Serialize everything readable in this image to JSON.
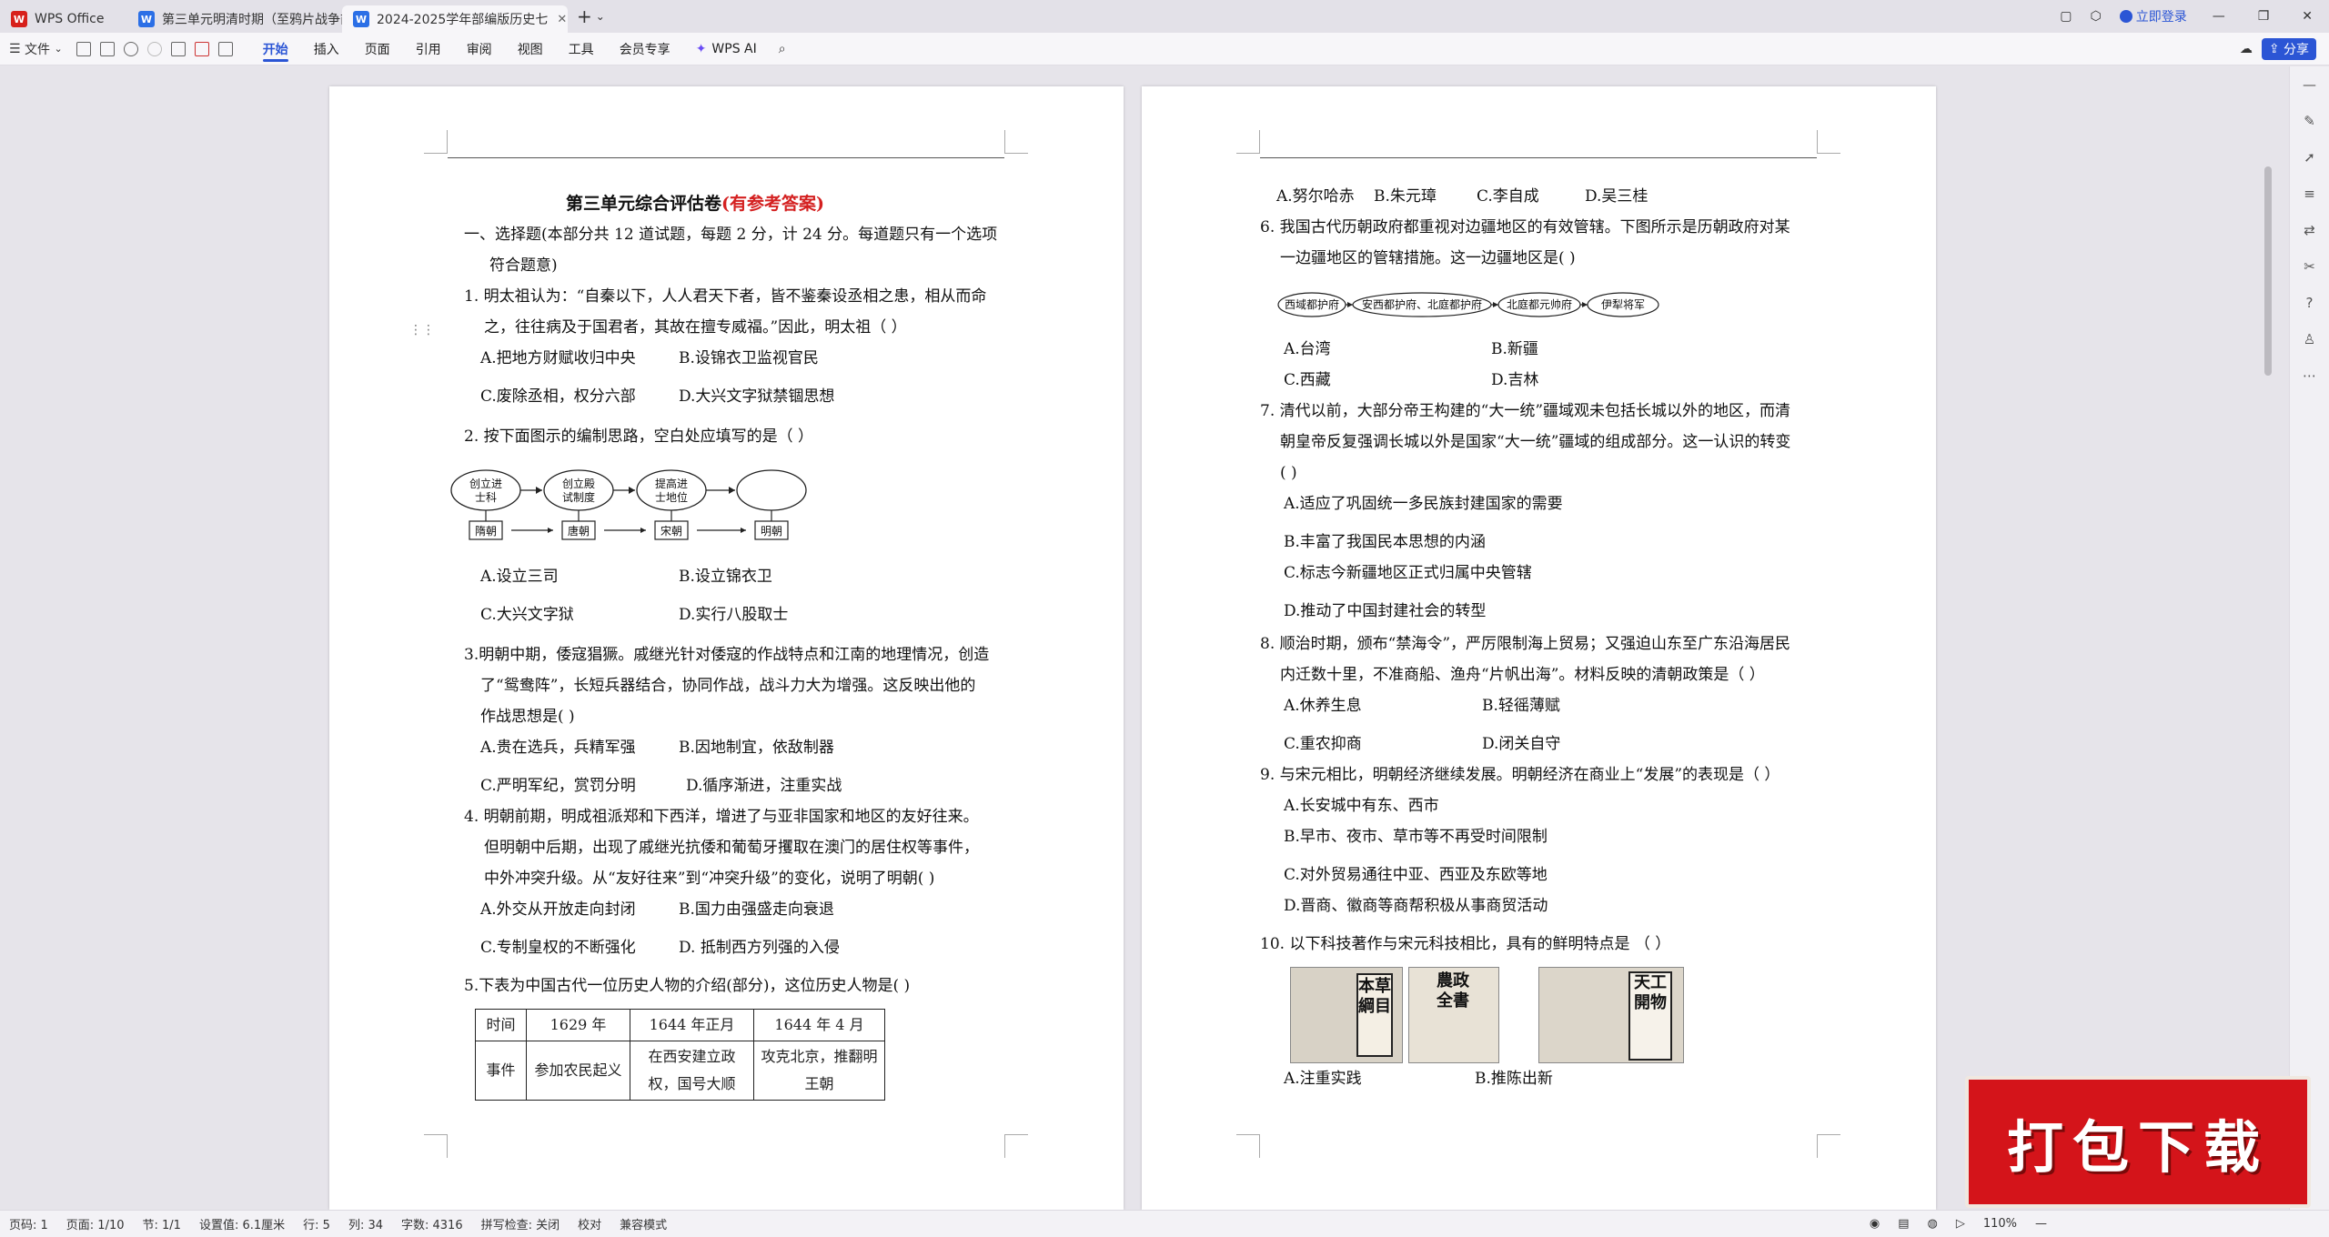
{
  "tabs": [
    {
      "label": "WPS Office",
      "icon": "wps-logo-icon"
    },
    {
      "label": "第三单元明清时期（至鸦片战争前）"
    },
    {
      "label": "2024-2025学年部编版历史七"
    }
  ],
  "topright": {
    "login": "立即登录",
    "share": "分享"
  },
  "toolbar": {
    "file": "文件",
    "menus": [
      "开始",
      "插入",
      "页面",
      "引用",
      "审阅",
      "视图",
      "工具",
      "会员专享"
    ],
    "ai": "WPS AI"
  },
  "doc": {
    "title": "第三单元综合评估卷",
    "title_red": "(有参考答案)",
    "p1": [
      "一、选择题(本部分共 12 道试题，每题 2 分，计 24 分。每道题只有一个选项",
      "符合题意)",
      "1.  明太祖认为：“自秦以下，人人君天下者，皆不鉴秦设丞相之患，相从而命",
      "之，往往病及于国君者，其故在擅专威福。”因此，明太祖（    ）",
      "A.把地方财赋收归中央",
      "B.设锦衣卫监视官民",
      "C.废除丞相，权分六部",
      "D.大兴文字狱禁锢思想",
      "2.  按下面图示的编制思路，空白处应填写的是（      ）",
      "A.设立三司",
      "B.设立锦衣卫",
      "C.大兴文字狱",
      "D.实行八股取士",
      "3.明朝中期，倭寇猖獗。戚继光针对倭寇的作战特点和江南的地理情况，创造",
      "了“鸳鸯阵”，长短兵器结合，协同作战，战斗力大为增强。这反映出他的",
      "作战思想是(      )",
      "A.贵在选兵，兵精军强",
      "B.因地制宜，依敌制器",
      "C.严明军纪，赏罚分明",
      "D.循序渐进，注重实战",
      "4.  明朝前期，明成祖派郑和下西洋，增进了与亚非国家和地区的友好往来。",
      "但明朝中后期，出现了戚继光抗倭和葡萄牙攫取在澳门的居住权等事件，",
      "中外冲突升级。从“友好往来”到“冲突升级”的变化，说明了明朝(      )",
      "A.外交从开放走向封闭",
      "B.国力由强盛走向衰退",
      "C.专制皇权的不断强化",
      "D.  抵制西方列强的入侵",
      "5.下表为中国古代一位历史人物的介绍(部分)，这位历史人物是(      )"
    ],
    "diag2": {
      "boxes": [
        "创立进士科",
        "创立殿试制度",
        "提高进士地位",
        ""
      ],
      "labels": [
        "隋朝",
        "唐朝",
        "宋朝",
        "明朝"
      ]
    },
    "table5": {
      "h": [
        "时间",
        "1629 年",
        "1644 年正月",
        "1644  年  4 月"
      ],
      "r": [
        "事件",
        "参加农民起义",
        "在西安建立政权，国号大顺",
        "攻克北京，推翻明王朝"
      ]
    },
    "p2": [
      "A.努尔哈赤",
      "B.朱元璋",
      "C.李自成",
      "D.吴三桂",
      "6.  我国古代历朝政府都重视对边疆地区的有效管辖。下图所示是历朝政府对某",
      "一边疆地区的管辖措施。这一边疆地区是(      )",
      "A.台湾",
      "B.新疆",
      "C.西藏",
      "D.吉林",
      "7.  清代以前，大部分帝王构建的“大一统”疆域观未包括长城以外的地区，而清",
      "朝皇帝反复强调长城以外是国家“大一统”疆域的组成部分。这一认识的转变",
      "(      )",
      "A.适应了巩固统一多民族封建国家的需要",
      "B.丰富了我国民本思想的内涵",
      "C.标志今新疆地区正式归属中央管辖",
      "D.推动了中国封建社会的转型",
      "8.  顺治时期，颁布“禁海令”，严厉限制海上贸易；又强迫山东至广东沿海居民",
      "内迁数十里，不准商船、渔舟“片帆出海”。材料反映的清朝政策是（     ）",
      "A.休养生息",
      "B.轻徭薄赋",
      "C.重农抑商",
      "D.闭关自守",
      "9.  与宋元相比，明朝经济继续发展。明朝经济在商业上“发展”的表现是（     ）",
      "A.长安城中有东、西市",
      "B.早市、夜市、草市等不再受时间限制",
      "C.对外贸易通往中亚、西亚及东欧等地",
      "D.晋商、徽商等商帮积极从事商贸活动",
      "10.  以下科技著作与宋元科技相比，具有的鲜明特点是   （     ）",
      "A.注重实践",
      "B.推陈出新"
    ],
    "diag6": [
      "西域都护府",
      "安西都护府、北庭都护府",
      "北庭都元帅府",
      "伊犁将军"
    ],
    "books": [
      "本草綱目",
      "農政全書",
      "天工開物"
    ]
  },
  "status": {
    "items": [
      "页码: 1",
      "页面: 1/10",
      "节: 1/1",
      "设置值: 6.1厘米",
      "行: 5",
      "列: 34",
      "字数: 4316",
      "拼写检查: 关闭",
      "校对",
      "兼容模式"
    ],
    "zoom": "110%"
  },
  "promo": "打包下载"
}
